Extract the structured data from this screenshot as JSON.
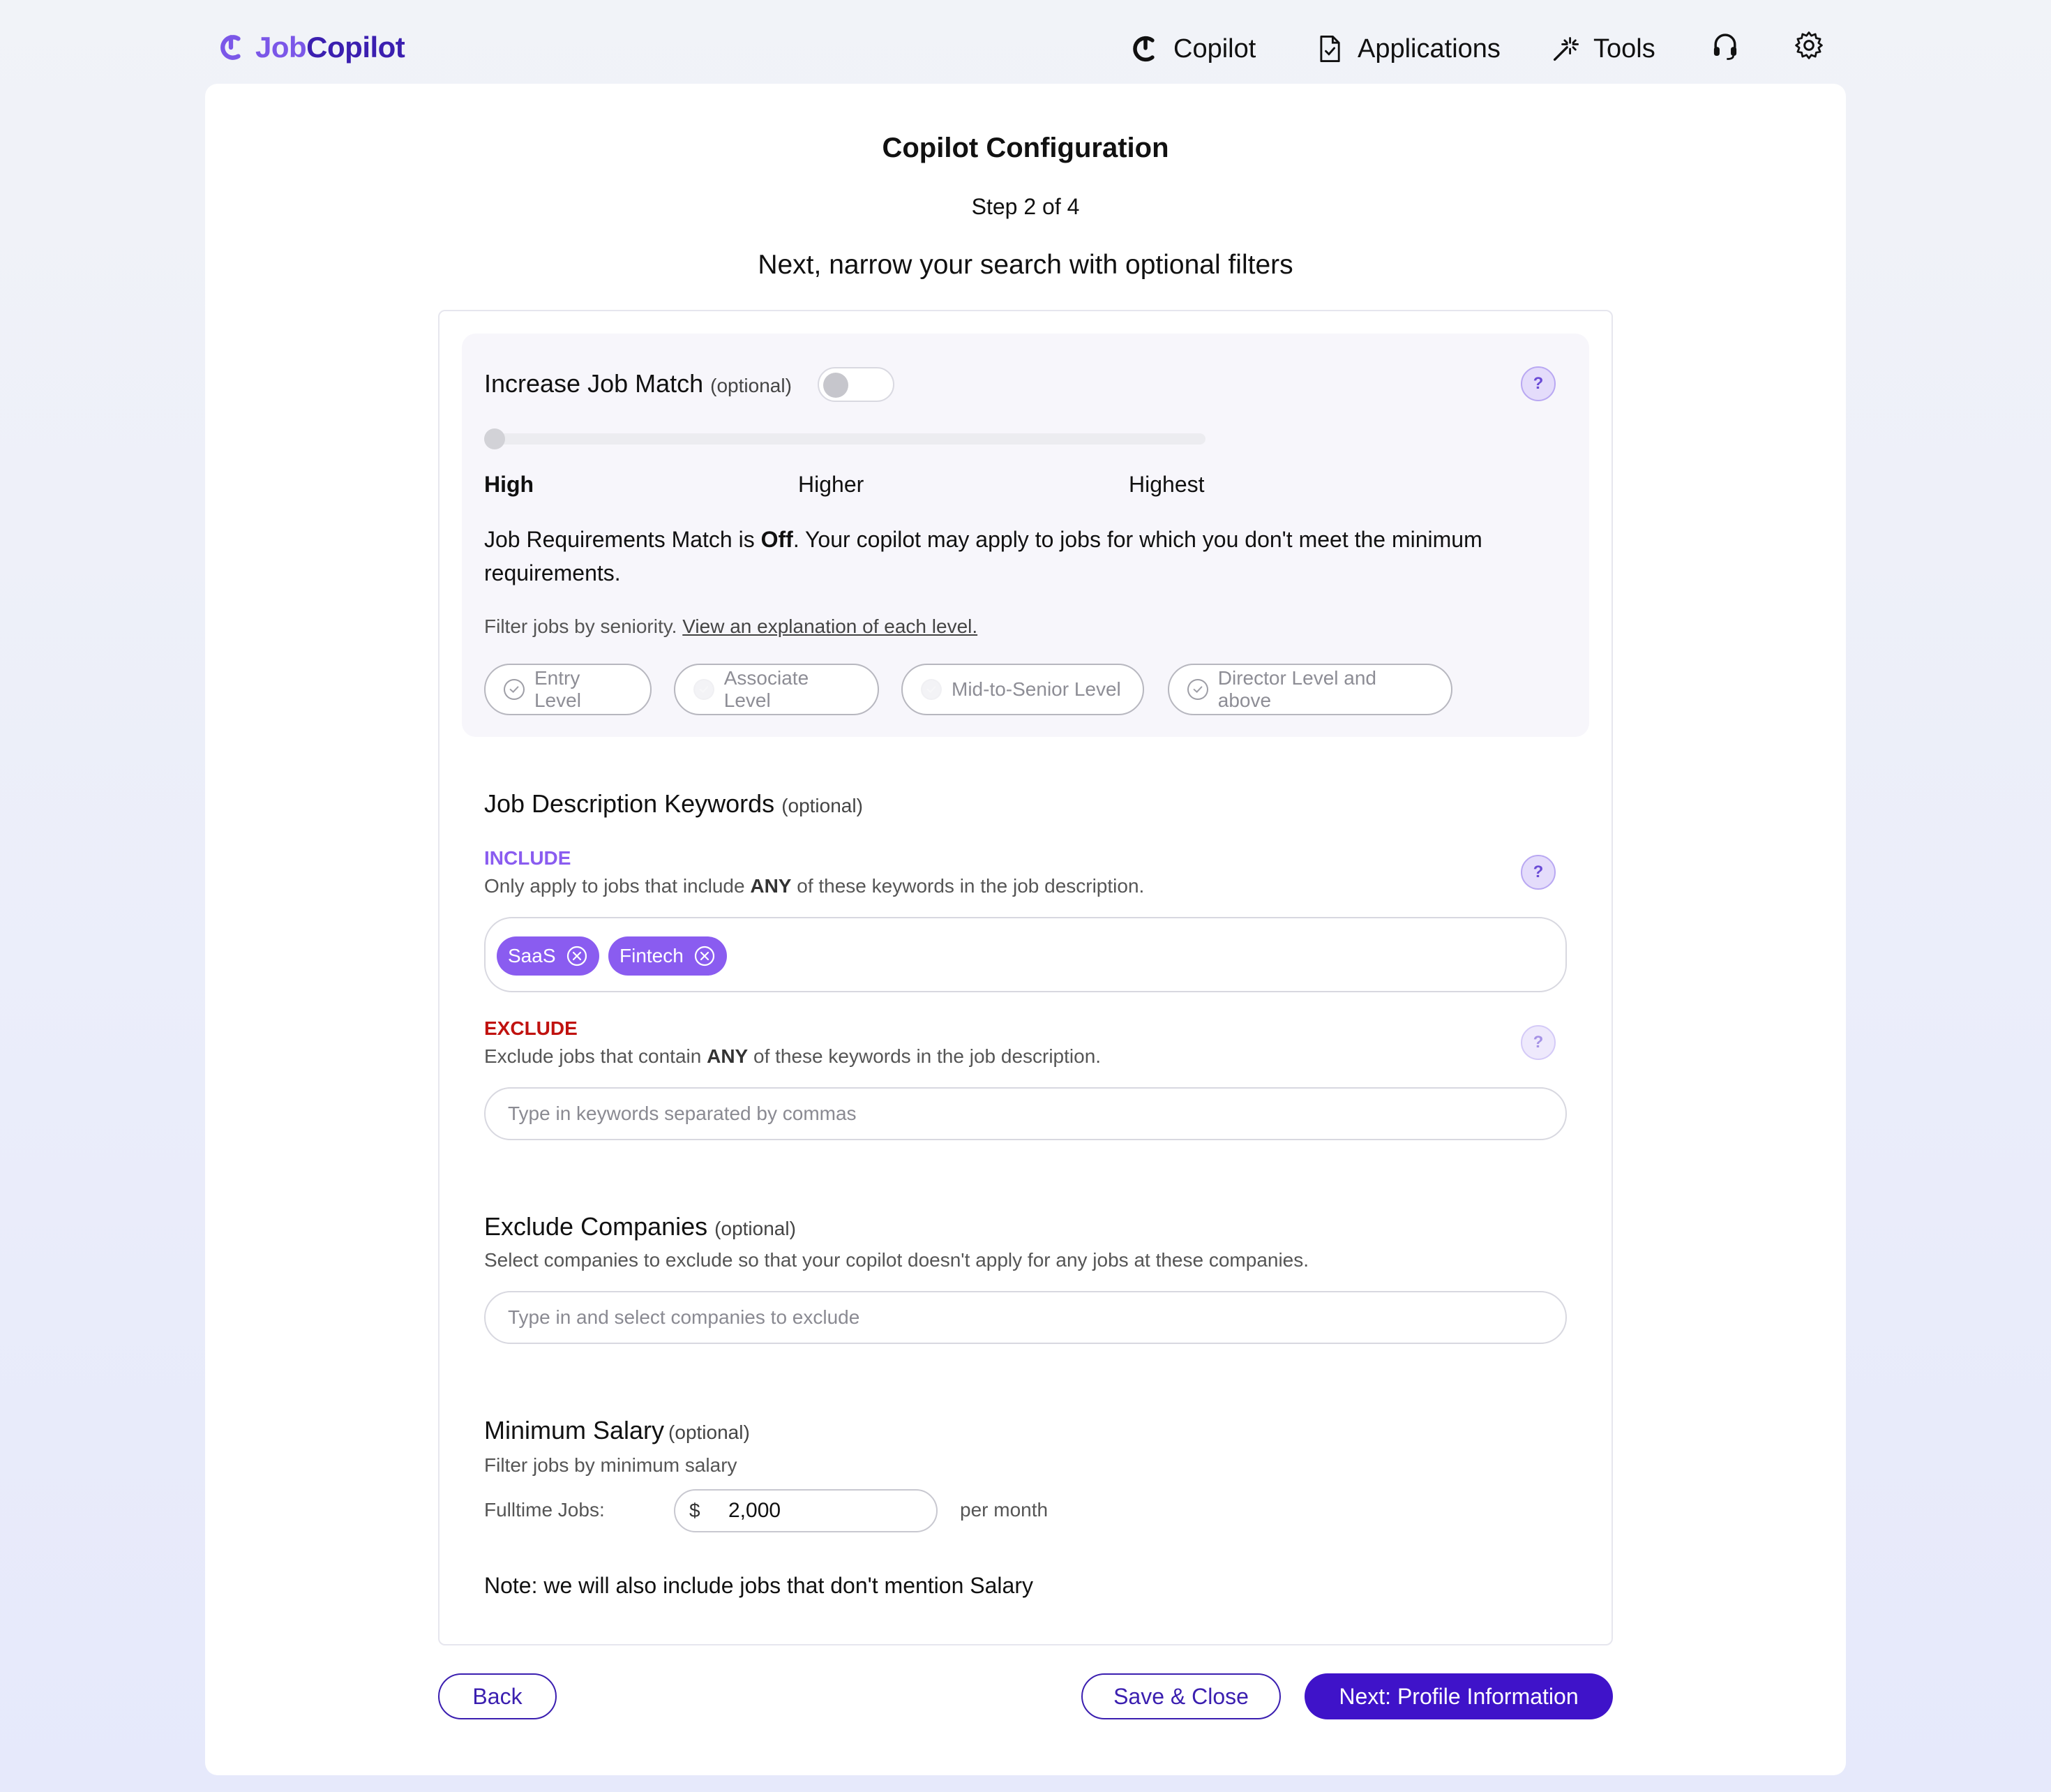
{
  "brand": {
    "name_part1": "Job",
    "name_part2": "Copilot"
  },
  "nav": {
    "copilot": "Copilot",
    "applications": "Applications",
    "tools": "Tools"
  },
  "page": {
    "title": "Copilot Configuration",
    "step": "Step 2 of 4",
    "subtitle": "Next, narrow your search with optional filters"
  },
  "job_match": {
    "title": "Increase Job Match",
    "optional": "(optional)",
    "toggle_on": false,
    "levels": [
      "High",
      "Higher",
      "Highest"
    ],
    "req_prefix": "Job Requirements Match is ",
    "req_state": "Off",
    "req_suffix": ". Your copilot may apply to jobs for which you don't meet the minimum requirements.",
    "filter_text": "Filter jobs by seniority. ",
    "filter_link": "View an explanation of each level.",
    "seniority": [
      "Entry Level",
      "Associate Level",
      "Mid-to-Senior Level",
      "Director Level and above"
    ]
  },
  "keywords": {
    "title": "Job Description Keywords",
    "optional": "(optional)",
    "include_label": "INCLUDE",
    "include_desc_pre": "Only apply to jobs that include ",
    "include_desc_bold": "ANY",
    "include_desc_post": " of these keywords in the job description.",
    "include_tags": [
      "SaaS",
      "Fintech"
    ],
    "exclude_label": "EXCLUDE",
    "exclude_desc_pre": "Exclude jobs that contain ",
    "exclude_desc_bold": "ANY",
    "exclude_desc_post": " of these keywords in the job description.",
    "exclude_placeholder": "Type in keywords separated by commas"
  },
  "companies": {
    "title": "Exclude Companies",
    "optional": "(optional)",
    "desc": "Select companies to exclude so that your copilot doesn't apply for any jobs at these companies.",
    "placeholder": "Type in and select companies to exclude"
  },
  "salary": {
    "title": "Minimum Salary",
    "optional": "(optional)",
    "desc": "Filter jobs by minimum salary",
    "fulltime_label": "Fulltime Jobs:",
    "currency": "$",
    "amount": "2,000",
    "period": "per month",
    "note": "Note: we will also include jobs that don't mention Salary"
  },
  "footer": {
    "back": "Back",
    "save_close": "Save & Close",
    "next": "Next: Profile Information"
  },
  "colors": {
    "accent": "#3f13c9",
    "tag": "#8a5cf0",
    "include": "#8a5cf0",
    "exclude": "#c0120f"
  },
  "icons": {
    "logo": "copilot-logo-icon",
    "copilot": "copilot-icon",
    "applications": "document-check-icon",
    "tools": "magic-wand-icon",
    "support": "headset-icon",
    "settings": "gear-icon"
  }
}
